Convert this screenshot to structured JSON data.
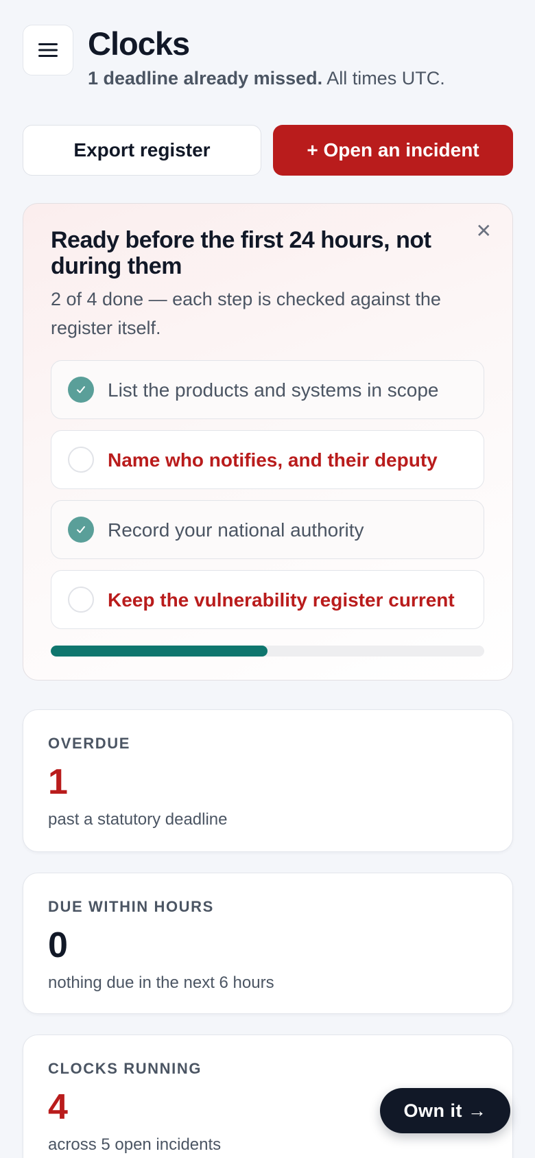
{
  "header": {
    "menu_icon": "hamburger-menu-icon",
    "title": "Clocks",
    "subtitle_bold": "1 deadline already missed.",
    "subtitle_rest": "All times UTC."
  },
  "actions": {
    "export_label": "Export register",
    "incident_label": "+ Open an incident"
  },
  "readiness": {
    "title": "Ready before the first 24 hours, not during them",
    "subtitle": "2 of 4 done — each step is checked against the register itself.",
    "close_icon": "close-icon",
    "progress": 0.5,
    "steps": [
      {
        "label": "List the products and systems in scope",
        "done": true
      },
      {
        "label": "Name who notifies, and their deputy",
        "done": false
      },
      {
        "label": "Record your national authority",
        "done": true
      },
      {
        "label": "Keep the vulnerability register current",
        "done": false
      }
    ]
  },
  "stats": [
    {
      "label": "OVERDUE",
      "value": "1",
      "note": "past a statutory deadline",
      "color": "#b91c1c"
    },
    {
      "label": "DUE WITHIN HOURS",
      "value": "0",
      "note": "nothing due in the next 6 hours",
      "color": "#111827"
    },
    {
      "label": "CLOCKS RUNNING",
      "value": "4",
      "note": "across 5 open incidents",
      "color": "#b91c1c"
    }
  ],
  "fab": {
    "label": "Own it →"
  },
  "colors": {
    "accent_red": "#b91c1c",
    "done_teal": "#5a9f99",
    "progress_teal": "#0f766e"
  }
}
